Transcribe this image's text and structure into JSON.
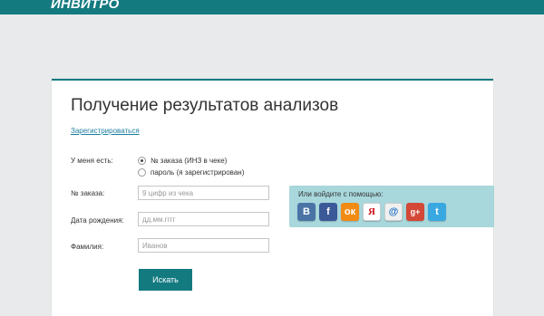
{
  "header": {
    "logo": "ИНВИТРО",
    "colors": {
      "brand": "#137a80"
    }
  },
  "form": {
    "title": "Получение результатов анализов",
    "register_link": "Зарегистрироваться",
    "have_label": "У меня есть:",
    "options": [
      {
        "label": "№ заказа (ИНЗ в чеке)",
        "checked": true
      },
      {
        "label": "пароль (я зарегистрирован)",
        "checked": false
      }
    ],
    "order_label": "№ заказа:",
    "order_placeholder": "9 цифр из чека",
    "birth_label": "Дата рождения:",
    "birth_placeholder": "дд.мм.гггг",
    "surname_label": "Фамилия:",
    "surname_placeholder": "Иванов",
    "submit_label": "Искать"
  },
  "social": {
    "title": "Или войдите с помощью:",
    "icons": [
      {
        "name": "vkontakte-icon",
        "glyph": "В"
      },
      {
        "name": "facebook-icon",
        "glyph": "f"
      },
      {
        "name": "odnoklassniki-icon",
        "glyph": "ок"
      },
      {
        "name": "yandex-icon",
        "glyph": "Я"
      },
      {
        "name": "mailru-icon",
        "glyph": "@"
      },
      {
        "name": "google-plus-icon",
        "glyph": "g+"
      },
      {
        "name": "twitter-icon",
        "glyph": "t"
      }
    ]
  }
}
